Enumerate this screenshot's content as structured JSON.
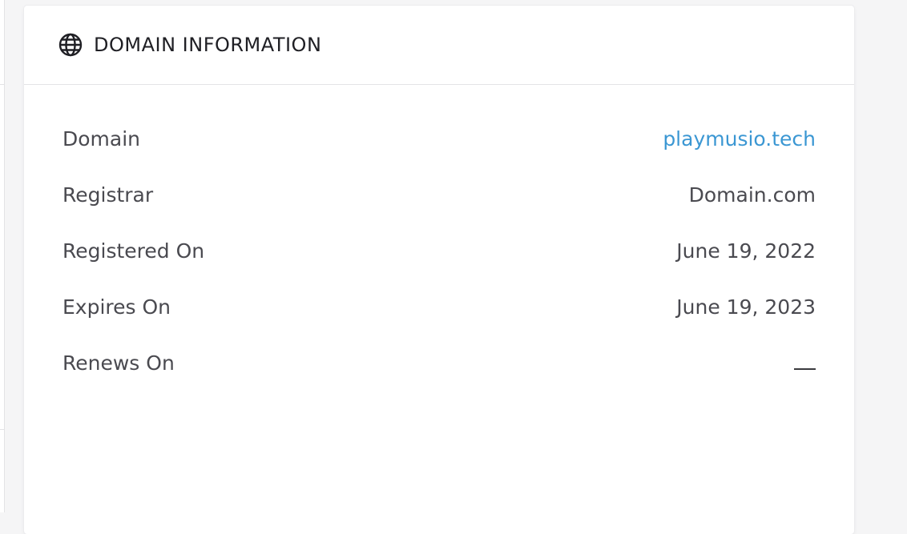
{
  "card": {
    "title": "DOMAIN INFORMATION",
    "icon": "globe-icon"
  },
  "rows": [
    {
      "label": "Domain",
      "value": "playmusio.tech",
      "is_link": true
    },
    {
      "label": "Registrar",
      "value": "Domain.com"
    },
    {
      "label": "Registered On",
      "value": "June 19, 2022"
    },
    {
      "label": "Expires On",
      "value": "June 19, 2023"
    },
    {
      "label": "Renews On",
      "value": "—"
    }
  ],
  "colors": {
    "link": "#3b97d3",
    "text": "#4a4a50",
    "title": "#1f1f24"
  }
}
